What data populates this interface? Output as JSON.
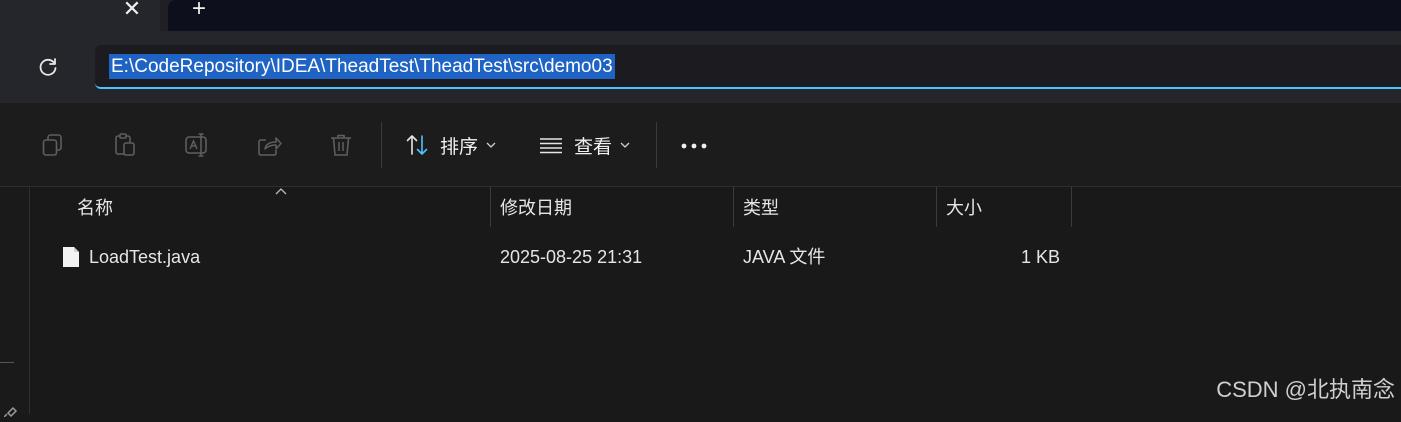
{
  "tabstrip": {
    "close_glyph": "✕",
    "new_tab_glyph": "+"
  },
  "address_bar": {
    "path": "E:\\CodeRepository\\IDEA\\TheadTest\\TheadTest\\src\\demo03"
  },
  "toolbar": {
    "icons": [
      "copy-icon",
      "paste-icon",
      "rename-icon",
      "share-icon",
      "delete-icon"
    ],
    "sort_label": "排序",
    "view_label": "查看",
    "more_glyph": "···"
  },
  "columns": {
    "name": "名称",
    "date_modified": "修改日期",
    "type": "类型",
    "size": "大小"
  },
  "files": [
    {
      "name": "LoadTest.java",
      "date_modified": "2025-08-25 21:31",
      "type": "JAVA 文件",
      "size": "1 KB"
    }
  ],
  "watermark": "CSDN @北执南念",
  "colors": {
    "accent": "#4cc2ff",
    "selection": "#1f64c4"
  }
}
